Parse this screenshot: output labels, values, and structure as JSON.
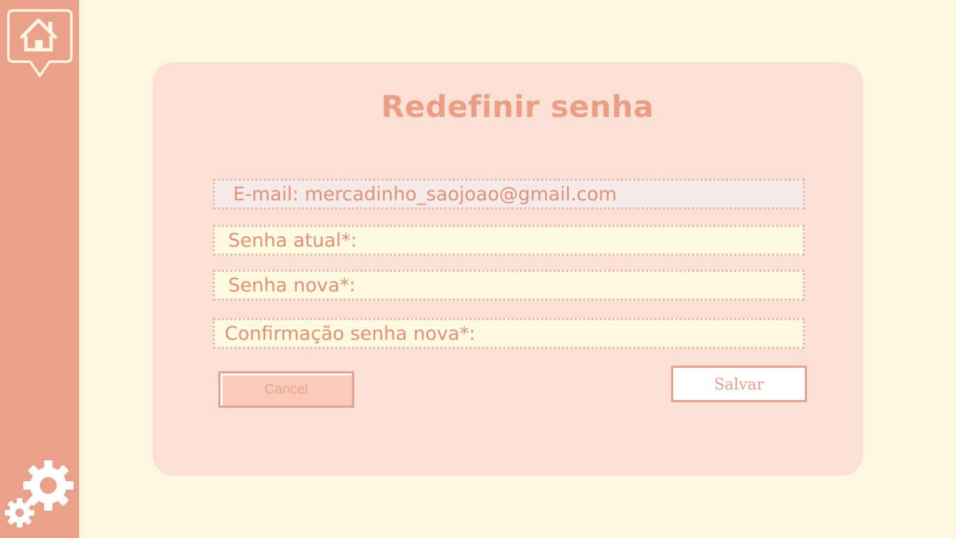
{
  "sidebar": {
    "home_icon": "home-icon",
    "settings_icon": "gears-icon"
  },
  "form": {
    "title": "Redefinir senha",
    "email_label": "E-mail: mercadinho_saojoao@gmail.com",
    "current_password_label": "Senha atual*:",
    "new_password_label": "Senha nova*:",
    "confirm_password_label": "Confirmação senha nova*:"
  },
  "buttons": {
    "cancel": "Cancel",
    "save": "Salvar"
  },
  "colors": {
    "background": "#fef7df",
    "sidebar": "#eba08a",
    "card": "#fde0d5",
    "accent": "#eb9e84"
  }
}
